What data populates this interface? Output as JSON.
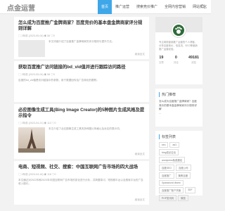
{
  "header": {
    "logo": "点金运营",
    "nav": [
      "首页",
      "推广运营",
      "搜索竞价推广",
      "全网内容营销",
      "网站优化"
    ]
  },
  "posts": [
    {
      "title": "怎么成为百度推广金牌商家？百度竞价的基本盘金牌商家评分规则详解",
      "meta": "▢ 2年前 (2023-05-04)  ◉ 56 ♡0",
      "excerpt": "本文详细介绍了百度推广金牌商家的评分规则与提升方法。",
      "read_more": "阅读全文",
      "thumb_text": ""
    },
    {
      "title": "获取百度推广访问链接的bd_vid值并进行跟踪访问路径",
      "meta": "▢ 2年前 (2023-05-04)  ◉ 58 ♡0",
      "excerpt": "百度的bd_vid值是访问链接中的参数，用于数据回传及广告转化的跟踪。",
      "read_more": "",
      "thumb_text": ""
    },
    {
      "title": "必应图像生成工具(Bing Image Creator)的5种图片生成风格及提示指令",
      "meta": "▢ 2年前 (2023-04-21)  ◉ 113 ♡0",
      "excerpt": "本文介绍了必应图像生成工具的多种图片风格以及对应的提示词。",
      "read_more": "阅读全文",
      "thumb_text": ""
    },
    {
      "title": "电商、短视频、社交、搜索：中国互联网广告市场的四大战场",
      "meta": "▢ 2年前 (2023-04-18)  ◉ 118 ♡0",
      "excerpt": "本文通过对2022年和2023年中国互联网广告市场的变化进行分析，并简要探讨，短视频平台以及搜索平台的广告收入增长。",
      "read_more": "阅读全文",
      "thumb_text": ""
    }
  ],
  "sidebar": {
    "profile_desc": "专注网络营销推广运营的个人博客，分享百度竞价、信息流、SEO等营销推广运营经验。",
    "stats": [
      {
        "value": "19",
        "label": "文章"
      },
      {
        "value": "0",
        "label": "评论"
      },
      {
        "value": "49181",
        "label": "浏览"
      }
    ],
    "recommend_title": "热门推荐",
    "recommend_items": [
      "怎么成为百度推广金牌商家？百度竞价的基本盘金牌商家评分规则详解",
      "..."
    ],
    "tags_title": "标签列表",
    "tags": [
      "seo",
      "ad1",
      "bing或必应出",
      "wordpress免费建站",
      "百度SEO",
      "百度公司",
      "百度推广",
      "聚焦百度",
      "Xpassword divest",
      "百度推广账户托管",
      "3DF",
      "PHP发代码",
      "微信"
    ]
  }
}
